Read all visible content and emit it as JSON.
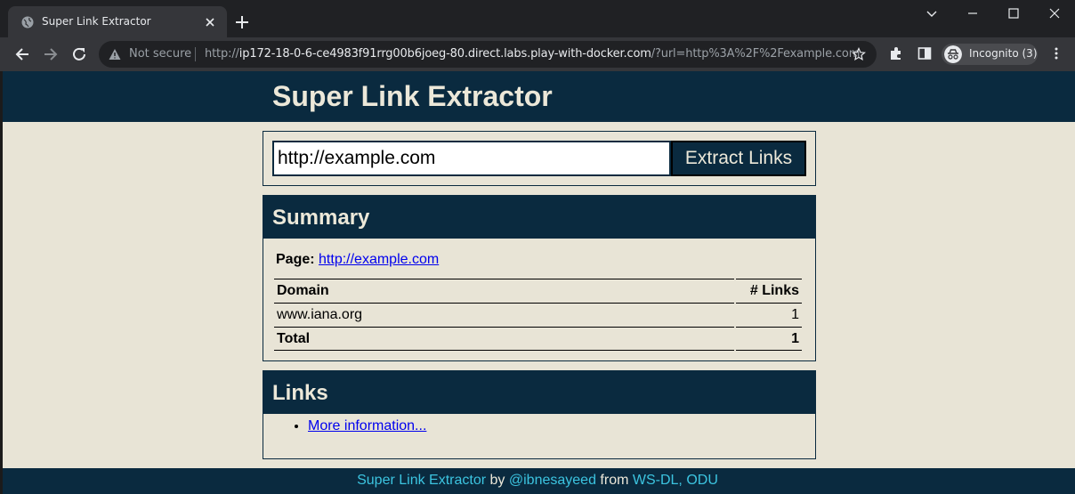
{
  "browser": {
    "tab_title": "Super Link Extractor",
    "security_label": "Not secure",
    "url_scheme": "http://",
    "url_host": "ip172-18-0-6-ce4983f91rrg00b6joeg-80.direct.labs.play-with-docker.com",
    "url_rest": "/?url=http%3A%2F%2Fexample.com",
    "incognito_label": "Incognito (3)"
  },
  "app": {
    "title": "Super Link Extractor",
    "url_input_value": "http://example.com",
    "extract_button_label": "Extract Links"
  },
  "summary": {
    "heading": "Summary",
    "page_label": "Page:",
    "page_link": "http://example.com",
    "table": {
      "headers": [
        "Domain",
        "# Links"
      ],
      "rows": [
        {
          "domain": "www.iana.org",
          "links": "1"
        }
      ],
      "total_label": "Total",
      "total_value": "1"
    }
  },
  "links": {
    "heading": "Links",
    "items": [
      "More information..."
    ]
  },
  "footer": {
    "app_name": "Super Link Extractor",
    "by": "by",
    "author": "@ibnesayeed",
    "from": "from",
    "org": "WS-DL, ODU"
  },
  "colors": {
    "header_bg": "#0a2a3f",
    "page_bg": "#e8e4d6",
    "footer_link": "#3cc4e0"
  }
}
